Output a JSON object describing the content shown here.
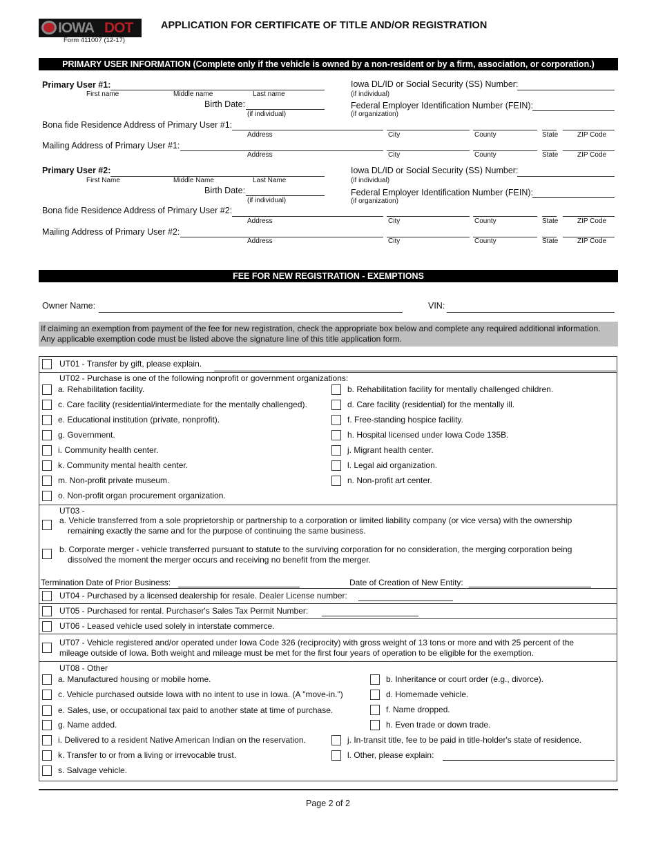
{
  "header": {
    "logo_iowa": "IOWA",
    "logo_dot": "DOT",
    "form_number": "Form 411007  (12-17)",
    "title": "APPLICATION FOR CERTIFICATE OF TITLE AND/OR REGISTRATION"
  },
  "primary_user_section": {
    "heading": "PRIMARY USER INFORMATION (Complete only if the vehicle is owned by a non-resident or by a firm, association, or corporation.)",
    "users": [
      {
        "label": "Primary User #1:",
        "first": "First name",
        "middle": "Middle name",
        "last": "Last name",
        "birth_date": "Birth Date:",
        "if_individual": "(if individual)",
        "dl_label": "Iowa DL/ID or Social Security (SS) Number:",
        "dl_note": "(if individual)",
        "fein_label": "Federal Employer Identification Number (FEIN):",
        "fein_note": "(if organization)",
        "residence_label": "Bona fide Residence Address of Primary User #1:",
        "mailing_label": "Mailing Address of Primary User #1:"
      },
      {
        "label": "Primary User #2:",
        "first": "First Name",
        "middle": "Middle Name",
        "last": "Last Name",
        "birth_date": "Birth Date:",
        "if_individual": "(if individual)",
        "dl_label": "Iowa DL/ID or Social Security (SS) Number:",
        "dl_note": "(if individual)",
        "fein_label": "Federal Employer Identification Number (FEIN):",
        "fein_note": "(if organization)",
        "residence_label": "Bona fide Residence Address of Primary User #2:",
        "mailing_label": "Mailing Address of Primary User #2:"
      }
    ],
    "address_parts": {
      "address": "Address",
      "city": "City",
      "county": "County",
      "state": "State",
      "zip": "ZIP Code"
    }
  },
  "exemptions_section": {
    "heading": "FEE FOR NEW REGISTRATION - EXEMPTIONS",
    "owner_name_label": "Owner Name:",
    "owner_name_value": "",
    "vin_label": "VIN:",
    "vin_value": "",
    "instructions": "If claiming an exemption from payment of the fee for new registration, check the appropriate box below and complete any required additional information. Any applicable exemption code must be listed above the signature line of this title application form.",
    "ut01": "UT01 - Transfer by gift, please explain.",
    "ut02": {
      "heading": "UT02 - Purchase is one of the following nonprofit or government organizations:",
      "items": [
        "a. Rehabilitation facility.",
        "b. Rehabilitation facility for mentally challenged children.",
        "c. Care facility (residential/intermediate for the mentally challenged).",
        "d. Care facility (residential) for the mentally ill.",
        "e. Educational institution (private, nonprofit).",
        "f.  Free-standing hospice facility.",
        "g. Government.",
        "h. Hospital licensed under Iowa Code 135B.",
        "i. Community health center.",
        "j.  Migrant health center.",
        "k. Community mental health center.",
        "l.  Legal aid organization.",
        "m. Non-profit private museum.",
        "n.  Non-profit art center.",
        "o. Non-profit organ procurement organization."
      ]
    },
    "ut03": {
      "heading": "UT03 -",
      "a_line1": "a. Vehicle transferred from a sole proprietorship or partnership to a corporation or limited liability company (or vice versa) with the ownership",
      "a_line2": "remaining exactly the same and for the purpose of continuing the same business.",
      "b_line1": "b. Corporate merger - vehicle transferred pursuant to statute to the surviving corporation for no consideration, the merging corporation being",
      "b_line2": "dissolved the moment the merger occurs and receiving no benefit from the merger.",
      "termination_label": "Termination Date of Prior Business:",
      "creation_label": "Date of Creation of New Entity:"
    },
    "ut04": "UT04 - Purchased by a licensed dealership for resale. Dealer License number:",
    "ut05": "UT05 - Purchased for rental. Purchaser's  Sales Tax Permit Number:",
    "ut06": "UT06 - Leased vehicle used solely in interstate commerce.",
    "ut07_line1": "UT07 - Vehicle registered and/or operated under Iowa Code 326 (reciprocity) with gross weight of 13 tons or more and with 25 percent of the",
    "ut07_line2": "mileage outside of Iowa. Both weight and mileage must be met for the first four years of operation to be eligible for the exemption.",
    "ut08": {
      "heading": "UT08 - Other",
      "items": [
        "a. Manufactured housing or mobile home.",
        "b. Inheritance or court order (e.g., divorce).",
        "c. Vehicle purchased outside Iowa with no intent to use in Iowa. (A \"move-in.\")",
        "d. Homemade vehicle.",
        "e. Sales, use, or occupational tax paid to another state at time of purchase.",
        "f.  Name dropped.",
        "g. Name added.",
        "h. Even trade or down trade.",
        "i. Delivered to a resident Native American Indian on the reservation.",
        "j.  In-transit title, fee to be paid in title-holder's state of residence.",
        "k. Transfer to or from a living or irrevocable trust.",
        "l.  Other, please explain:",
        "s. Salvage vehicle."
      ]
    }
  },
  "footer": {
    "page": "Page 2 of 2"
  }
}
